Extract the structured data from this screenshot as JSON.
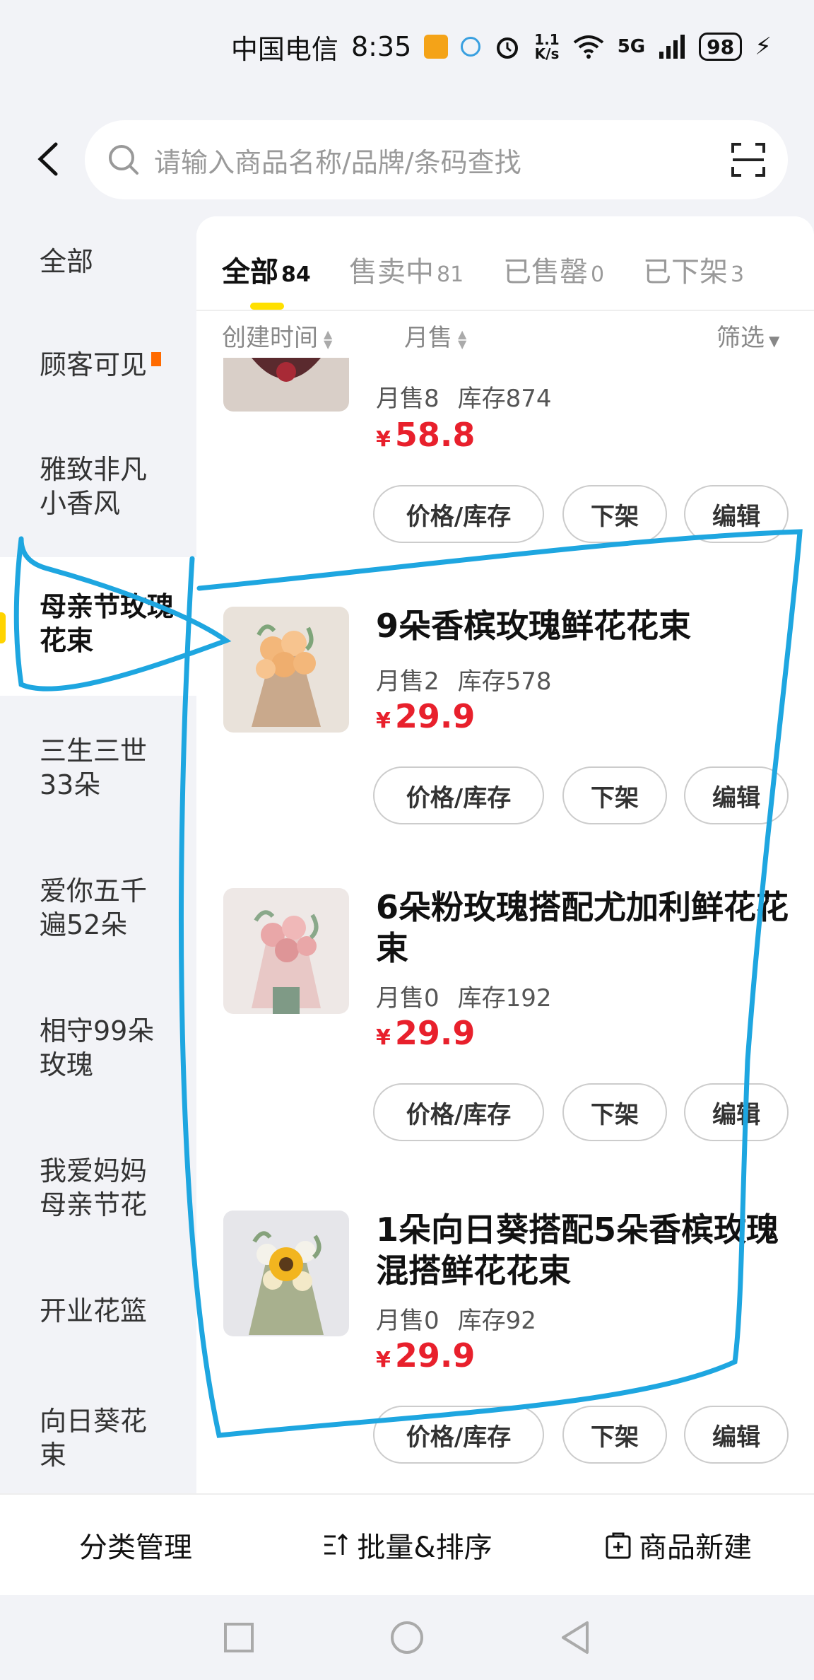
{
  "status_bar": {
    "carrier": "中国电信",
    "time": "8:35",
    "speed_top": "1.1",
    "speed_bottom": "K/s",
    "network": "5G",
    "battery": "98"
  },
  "search": {
    "placeholder": "请输入商品名称/品牌/条码查找"
  },
  "sidebar": {
    "items": [
      {
        "label": "全部"
      },
      {
        "label": "顾客可见"
      },
      {
        "label": "雅致非凡小香风"
      },
      {
        "label": "母亲节玫瑰花束"
      },
      {
        "label": "三生三世33朵"
      },
      {
        "label": "爱你五千遍52朵"
      },
      {
        "label": "相守99朵玫瑰"
      },
      {
        "label": "我爱妈妈母亲节花"
      },
      {
        "label": "开业花篮"
      },
      {
        "label": "向日葵花束"
      }
    ],
    "active_index": 3
  },
  "tabs": [
    {
      "label": "全部",
      "count": "84"
    },
    {
      "label": "售卖中",
      "count": "81"
    },
    {
      "label": "已售罄",
      "count": "0"
    },
    {
      "label": "已下架",
      "count": "3"
    }
  ],
  "sort": {
    "created": "创建时间",
    "monthly": "月售",
    "filter": "筛选"
  },
  "buttons": {
    "price_stock": "价格/库存",
    "delist": "下架",
    "edit": "编辑"
  },
  "products": [
    {
      "name": "",
      "sales": "月售8",
      "stock": "库存874",
      "price": "58.8"
    },
    {
      "name": "9朵香槟玫瑰鲜花花束",
      "sales": "月售2",
      "stock": "库存578",
      "price": "29.9"
    },
    {
      "name": "6朵粉玫瑰搭配尤加利鲜花花束",
      "sales": "月售0",
      "stock": "库存192",
      "price": "29.9"
    },
    {
      "name": "1朵向日葵搭配5朵香槟玫瑰混搭鲜花花束",
      "sales": "月售0",
      "stock": "库存92",
      "price": "29.9"
    }
  ],
  "currency": "¥",
  "bottom": {
    "category": "分类管理",
    "batch": "批量&排序",
    "new": "商品新建"
  },
  "colors": {
    "accent": "#ffe000",
    "price": "#e8202c",
    "annotation": "#1ea6e0"
  }
}
